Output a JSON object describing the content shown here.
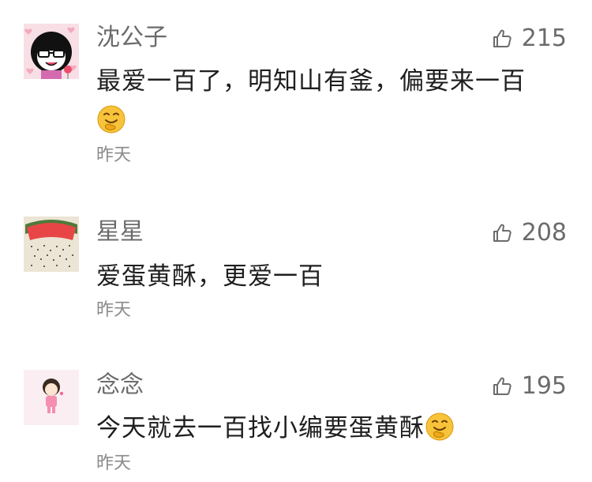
{
  "comments": [
    {
      "user": "沈公子",
      "likes": "215",
      "text": "最爱一百了，明知山有釜，偏要来一百",
      "emoji": "thinking-face-emoji",
      "time": "昨天",
      "avatar": "cartoon-girl-glasses-avatar"
    },
    {
      "user": "星星",
      "likes": "208",
      "text": "爱蛋黄酥，更爱一百",
      "time": "昨天",
      "avatar": "watermelon-avatar"
    },
    {
      "user": "念念",
      "likes": "195",
      "text": "今天就去一百找小编要蛋黄酥",
      "emoji": "thinking-face-emoji",
      "time": "昨天",
      "avatar": "pink-cartoon-girl-avatar"
    }
  ],
  "colors": {
    "name": "#6b6b6b",
    "text": "#1f1f1f",
    "time": "#8a8a8a",
    "background": "#ffffff"
  },
  "icons": {
    "like": "thumbs-up-icon"
  }
}
